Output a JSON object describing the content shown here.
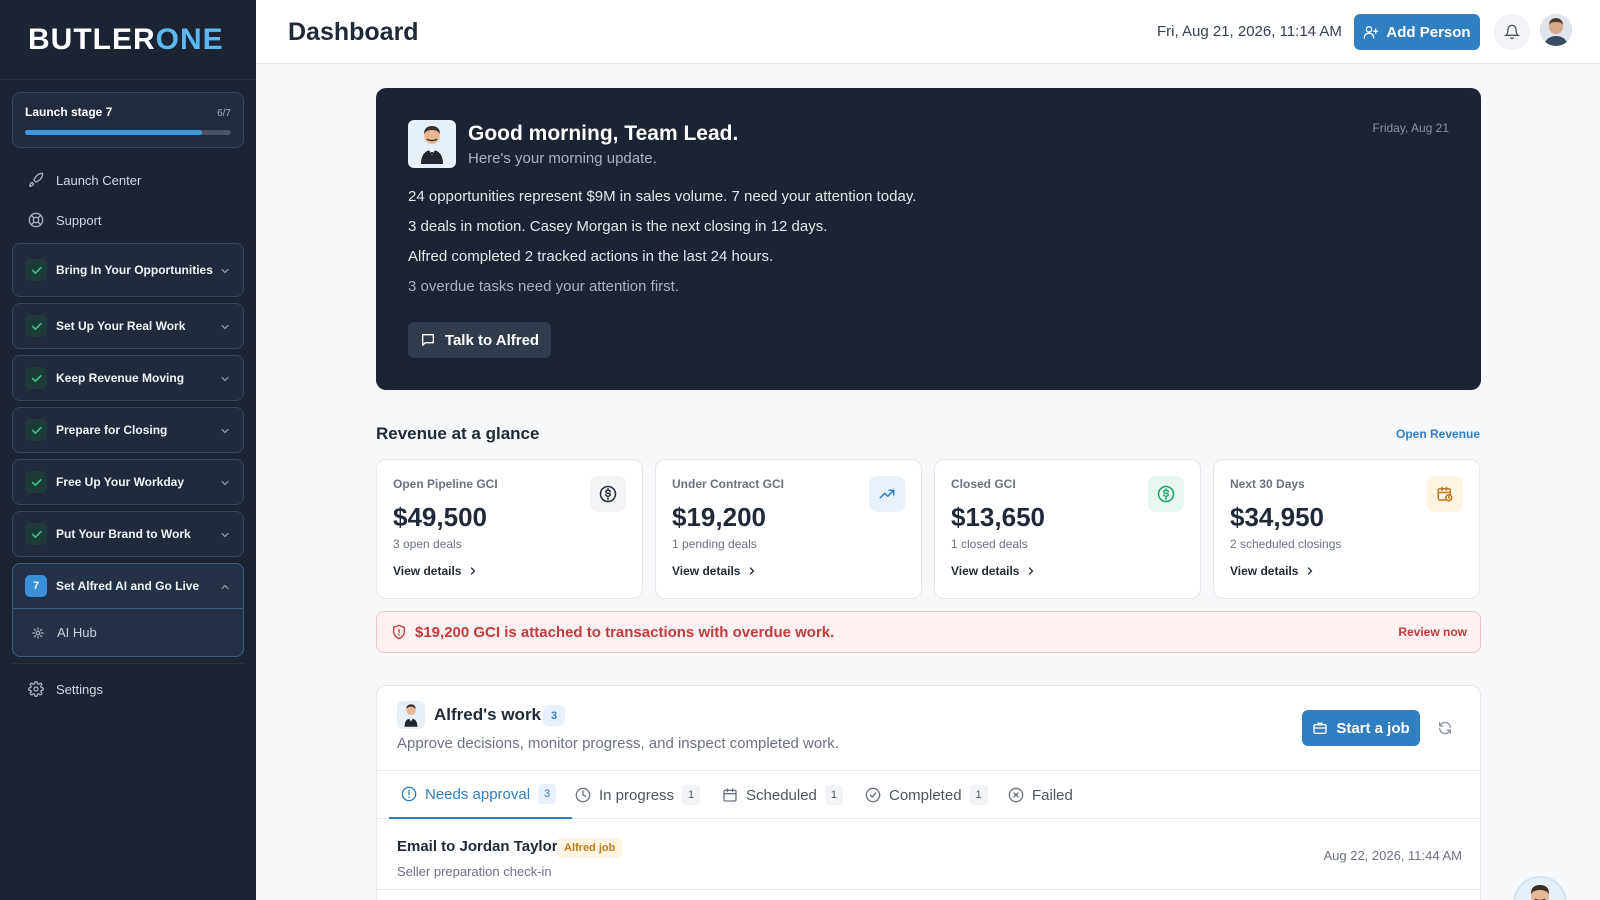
{
  "app": {
    "logo_text_a": "BUTLER",
    "logo_text_b": "ONE",
    "page_title": "Dashboard",
    "datetime": "Fri, Aug 21, 2026, 11:14 AM",
    "add_person_label": "Add Person",
    "accent": "#2f7fc1"
  },
  "sidebar": {
    "launch": {
      "title": "Launch stage 7",
      "count": "6/7",
      "progress": 0.857
    },
    "links_top": [
      {
        "label": "Launch Center",
        "icon": "rocket-icon"
      },
      {
        "label": "Support",
        "icon": "lifebuoy-icon"
      }
    ],
    "steps": [
      {
        "label": "Bring In Your Opportunities",
        "status": "done"
      },
      {
        "label": "Set Up Your Real Work",
        "status": "done"
      },
      {
        "label": "Keep Revenue Moving",
        "status": "done"
      },
      {
        "label": "Prepare for Closing",
        "status": "done"
      },
      {
        "label": "Free Up Your Workday",
        "status": "done"
      },
      {
        "label": "Put Your Brand to Work",
        "status": "done"
      },
      {
        "label": "Set Alfred AI and Go Live",
        "status": "active",
        "number": "7"
      }
    ],
    "active_sub": {
      "label": "AI Hub",
      "icon": "sparkle-icon"
    },
    "settings_label": "Settings"
  },
  "hero": {
    "title": "Good morning, Team Lead.",
    "subtitle": "Here's your morning update.",
    "date": "Friday, Aug 21",
    "lines": [
      "24 opportunities represent $9M in sales volume. 7 need your attention today.",
      "3 deals in motion. Casey Morgan is the next closing in 12 days.",
      "Alfred completed 2 tracked actions in the last 24 hours.",
      "3 overdue tasks need your attention first."
    ],
    "cta_label": "Talk to Alfred"
  },
  "revenue": {
    "title": "Revenue at a glance",
    "link": "Open Revenue",
    "cards": [
      {
        "label": "Open Pipeline GCI",
        "value": "$49,500",
        "sub": "3 open deals",
        "link": "View details",
        "icon": "dollar-icon",
        "icon_bg": "#f3f4f6",
        "icon_color": "#1f2937"
      },
      {
        "label": "Under Contract GCI",
        "value": "$19,200",
        "sub": "1 pending deals",
        "link": "View details",
        "icon": "trend-up-icon",
        "icon_bg": "#e8f1fb",
        "icon_color": "#2f7fc1"
      },
      {
        "label": "Closed GCI",
        "value": "$13,650",
        "sub": "1 closed deals",
        "link": "View details",
        "icon": "dollar-icon",
        "icon_bg": "#e6f7ef",
        "icon_color": "#22a06b"
      },
      {
        "label": "Next 30 Days",
        "value": "$34,950",
        "sub": "2 scheduled closings",
        "link": "View details",
        "icon": "calendar-clock-icon",
        "icon_bg": "#fdf4e4",
        "icon_color": "#c07a1a"
      }
    ]
  },
  "alert": {
    "text": "$19,200 GCI is attached to transactions with overdue work.",
    "link": "Review now"
  },
  "work": {
    "title": "Alfred's work",
    "count": "3",
    "subtitle": "Approve decisions, monitor progress, and inspect completed work.",
    "start_label": "Start a job",
    "tabs": [
      {
        "label": "Needs approval",
        "count": "3",
        "icon": "alert-circle-icon"
      },
      {
        "label": "In progress",
        "count": "1",
        "icon": "clock-icon"
      },
      {
        "label": "Scheduled",
        "count": "1",
        "icon": "calendar-icon"
      },
      {
        "label": "Completed",
        "count": "1",
        "icon": "check-circle-icon"
      },
      {
        "label": "Failed",
        "count": "",
        "icon": "x-circle-icon"
      }
    ],
    "job": {
      "title": "Email to Jordan Taylor",
      "badge": "Alfred job",
      "sub": "Seller preparation check-in",
      "date": "Aug 22, 2026, 11:44 AM"
    }
  }
}
